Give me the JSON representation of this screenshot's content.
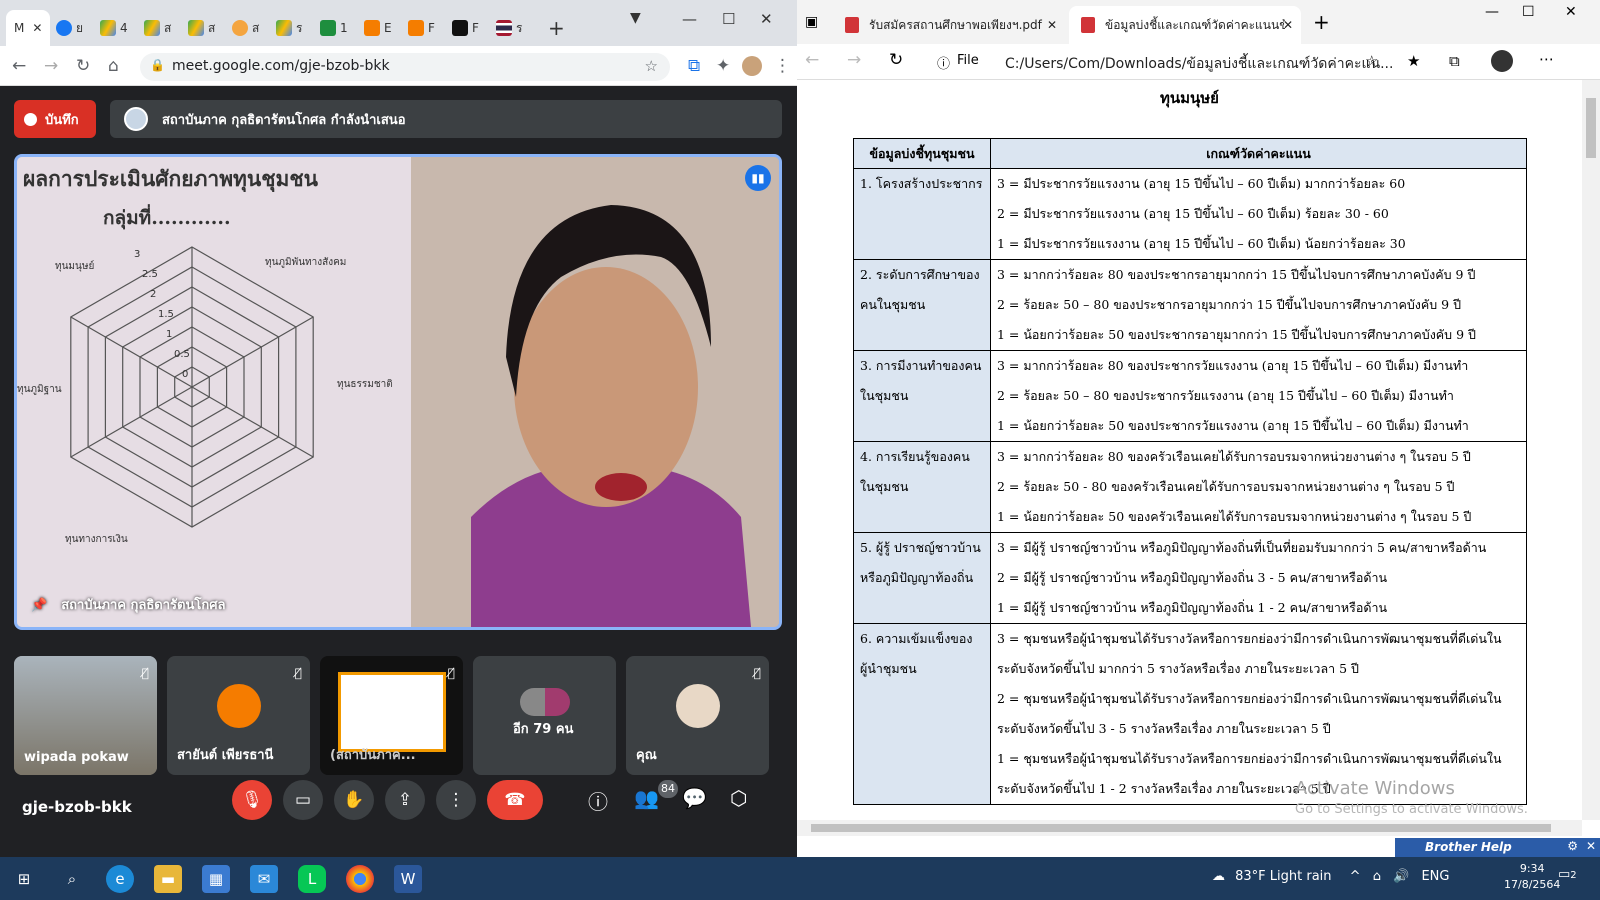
{
  "chrome": {
    "tabs": [
      "M",
      "ย",
      "4",
      "ส",
      "ส",
      "ส",
      "ร",
      "1",
      "E",
      "F",
      "ร"
    ],
    "new_tab": "+",
    "url": "meet.google.com/gje-bzob-bkk"
  },
  "meet": {
    "record_label": "บันทึก",
    "presenting_text": "สถาบันภาค กุลธิดารัตนโกศล กำลังนำเสนอ",
    "main_speaker": "สถาบันภาค กุลธิดารัตนโกศล",
    "poster": {
      "title": "ผลการประเมินศักยภาพทุนชุมชน",
      "group": "กลุ่มที่............",
      "axis_labels": [
        "ทุนมนุษย์",
        "ทุนภูมิพันทางสังคม",
        "ทุนธรรมชาติ",
        "ทุนทางการเงิน",
        "ทุนภูมิฐาน"
      ],
      "scale": [
        "3",
        "2.5",
        "2",
        "1.5",
        "1",
        "0.5",
        "0"
      ]
    },
    "tiles": [
      {
        "name": "wipada pokaw"
      },
      {
        "name": "สายันต์ เพียรธานี"
      },
      {
        "name": "(สถาบันภาค..."
      },
      {
        "name": "อีก 79 คน"
      },
      {
        "name": "คุณ"
      }
    ],
    "meeting_code": "gje-bzob-bkk",
    "participants_count": "84"
  },
  "edge": {
    "tabs": [
      {
        "label": "รับสมัครสถานศึกษาพอเพียงฯ.pdf"
      },
      {
        "label": "ข้อมูลบ่งชี้และเกณฑ์วัดค่าคะแนนข้อมู"
      }
    ],
    "file_label": "File",
    "url": "C:/Users/Com/Downloads/ข้อมูลบ่งชี้และเกณฑ์วัดค่าคะแน...",
    "doc_title": "ทุนมนุษย์",
    "table": {
      "headers": [
        "ข้อมูลบ่งชี้ทุนชุมชน",
        "เกณฑ์วัดค่าคะแนน"
      ],
      "rows": [
        {
          "indicator": [
            "1. โครงสร้างประชากร"
          ],
          "criteria": [
            "3 = มีประชากรวัยแรงงาน (อายุ 15 ปีขึ้นไป – 60 ปีเต็ม) มากกว่าร้อยละ 60",
            "2 = มีประชากรวัยแรงงาน (อายุ 15 ปีขึ้นไป – 60 ปีเต็ม) ร้อยละ 30 - 60",
            "1 = มีประชากรวัยแรงงาน (อายุ 15 ปีขึ้นไป – 60 ปีเต็ม) น้อยกว่าร้อยละ 30"
          ]
        },
        {
          "indicator": [
            "2. ระดับการศึกษาของ",
            "คนในชุมชน"
          ],
          "criteria": [
            "3 = มากกว่าร้อยละ 80 ของประชากรอายุมากกว่า 15 ปีขึ้นไปจบการศึกษาภาคบังคับ 9 ปี",
            "2 = ร้อยละ 50 – 80 ของประชากรอายุมากกว่า 15 ปีขึ้นไปจบการศึกษาภาคบังคับ 9 ปี",
            "1 = น้อยกว่าร้อยละ 50 ของประชากรอายุมากกว่า 15 ปีขึ้นไปจบการศึกษาภาคบังคับ 9 ปี"
          ]
        },
        {
          "indicator": [
            "3. การมีงานทำของคน",
            "ในชุมชน"
          ],
          "criteria": [
            "3 = มากกว่าร้อยละ 80 ของประชากรวัยแรงงาน (อายุ 15 ปีขึ้นไป – 60 ปีเต็ม) มีงานทำ",
            "2 = ร้อยละ 50 – 80 ของประชากรวัยแรงงาน (อายุ 15 ปีขึ้นไป – 60 ปีเต็ม) มีงานทำ",
            "1 = น้อยกว่าร้อยละ 50 ของประชากรวัยแรงงาน (อายุ 15 ปีขึ้นไป – 60 ปีเต็ม) มีงานทำ"
          ]
        },
        {
          "indicator": [
            "4. การเรียนรู้ของคน",
            "ในชุมชน"
          ],
          "criteria": [
            "3 = มากกว่าร้อยละ 80 ของครัวเรือนเคยได้รับการอบรมจากหน่วยงานต่าง ๆ ในรอบ 5 ปี",
            "2 = ร้อยละ 50 - 80 ของครัวเรือนเคยได้รับการอบรมจากหน่วยงานต่าง ๆ  ในรอบ 5 ปี",
            "1 = น้อยกว่าร้อยละ 50 ของครัวเรือนเคยได้รับการอบรมจากหน่วยงานต่าง ๆ  ในรอบ 5 ปี"
          ]
        },
        {
          "indicator": [
            "5. ผู้รู้ ปราชญ์ชาวบ้าน",
            "หรือภูมิปัญญาท้องถิ่น"
          ],
          "criteria": [
            "3 = มีผู้รู้ ปราชญ์ชาวบ้าน หรือภูมิปัญญาท้องถิ่นที่เป็นที่ยอมรับมากกว่า 5 คน/สาขาหรือด้าน",
            "2 = มีผู้รู้ ปราชญ์ชาวบ้าน หรือภูมิปัญญาท้องถิ่น 3 - 5  คน/สาขาหรือด้าน",
            "1 = มีผู้รู้ ปราชญ์ชาวบ้าน หรือภูมิปัญญาท้องถิ่น 1 - 2 คน/สาขาหรือด้าน"
          ]
        },
        {
          "indicator": [
            "6. ความเข้มแข็งของ",
            "ผู้นำชุมชน"
          ],
          "criteria": [
            "3 = ชุมชนหรือผู้นำชุมชนได้รับรางวัลหรือการยกย่องว่ามีการดำเนินการพัฒนาชุมชนที่ดีเด่นใน",
            "ระดับจังหวัดขึ้นไป มากกว่า 5 รางวัลหรือเรื่อง ภายในระยะเวลา 5 ปี",
            "2 = ชุมชนหรือผู้นำชุมชนได้รับรางวัลหรือการยกย่องว่ามีการดำเนินการพัฒนาชุมชนที่ดีเด่นใน",
            "ระดับจังหวัดขึ้นไป 3 - 5 รางวัลหรือเรื่อง ภายในระยะเวลา 5 ปี",
            "1 = ชุมชนหรือผู้นำชุมชนได้รับรางวัลหรือการยกย่องว่ามีการดำเนินการพัฒนาชุมชนที่ดีเด่นใน",
            "ระดับจังหวัดขึ้นไป 1 - 2 รางวัลหรือเรื่อง ภายในระยะเวลา 5 ปี"
          ]
        }
      ]
    },
    "watermark_title": "Activate Windows",
    "watermark_sub": "Go to Settings to activate Windows.",
    "brother_help": "Brother Help"
  },
  "taskbar": {
    "weather": "83°F  Light rain",
    "lang": "ENG",
    "time": "9:34",
    "date": "17/8/2564",
    "notif_count": "2"
  }
}
